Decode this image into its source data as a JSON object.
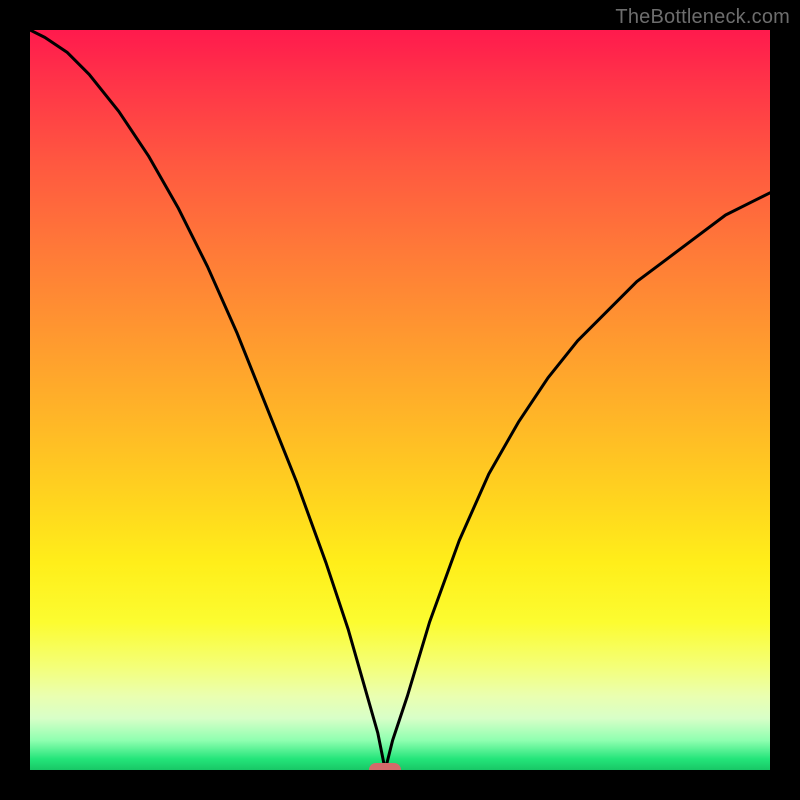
{
  "watermark": "TheBottleneck.com",
  "colors": {
    "frame_bg": "#000000",
    "curve_stroke": "#000000",
    "marker_fill": "#d46a6a",
    "watermark_text": "#6d6d6d",
    "gradient_top": "#ff1a4d",
    "gradient_mid": "#ffee1a",
    "gradient_bottom": "#18c766"
  },
  "chart_data": {
    "type": "line",
    "title": "",
    "xlabel": "",
    "ylabel": "",
    "xlim": [
      0,
      100
    ],
    "ylim": [
      0,
      100
    ],
    "grid": false,
    "legend": false,
    "notes": "V-shaped curve on a vertical red→yellow→green gradient. Minimum at x≈48. y values are estimated percentages of plot-area height from bottom (0=bottom, 100=top).",
    "series": [
      {
        "name": "curve",
        "x": [
          0,
          2,
          5,
          8,
          12,
          16,
          20,
          24,
          28,
          32,
          36,
          40,
          43,
          45,
          47,
          48,
          49,
          51,
          54,
          58,
          62,
          66,
          70,
          74,
          78,
          82,
          86,
          90,
          94,
          98,
          100
        ],
        "y": [
          100,
          99,
          97,
          94,
          89,
          83,
          76,
          68,
          59,
          49,
          39,
          28,
          19,
          12,
          5,
          0,
          4,
          10,
          20,
          31,
          40,
          47,
          53,
          58,
          62,
          66,
          69,
          72,
          75,
          77,
          78
        ]
      }
    ],
    "marker": {
      "x": 48,
      "y": 0,
      "shape": "rounded-rect"
    }
  }
}
